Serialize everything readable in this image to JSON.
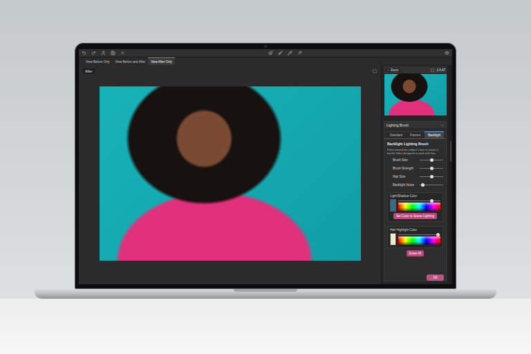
{
  "view_tabs": [
    {
      "label": "View Before Only",
      "selected": false
    },
    {
      "label": "View Before and After",
      "selected": false
    },
    {
      "label": "View After Only",
      "selected": true
    }
  ],
  "canvas": {
    "label": "After"
  },
  "navigator": {
    "zoom_label": "Zoom",
    "zoom_checked": true,
    "zoom_ratio": "1:4.47"
  },
  "panel": {
    "title": "Lighting Brush"
  },
  "brush_tabs": [
    {
      "label": "Standard",
      "selected": false
    },
    {
      "label": "Frames",
      "selected": false
    },
    {
      "label": "Backlight",
      "selected": true
    }
  ],
  "section": {
    "title": "Backlight Lighting Brush",
    "description": "Paint around the subject's hair to create a backlit effect designed to work with hair."
  },
  "sliders": [
    {
      "label": "Brush Size",
      "level": 0.5
    },
    {
      "label": "Brush Strength",
      "level": 0.5
    },
    {
      "label": "Hair Size",
      "level": 0.5
    },
    {
      "label": "Backlight Noise",
      "level": 0.12
    }
  ],
  "light_shadow": {
    "label": "Light/Shadow Color",
    "color": "#2f6f92",
    "level": 0.8,
    "button": "Set Color to Scene Lighting"
  },
  "hair_highlight": {
    "label": "Hair Highlight Color",
    "color": "#f1eccb",
    "level": 0.95
  },
  "erase_button": "Erase All",
  "ok_button": "OK"
}
